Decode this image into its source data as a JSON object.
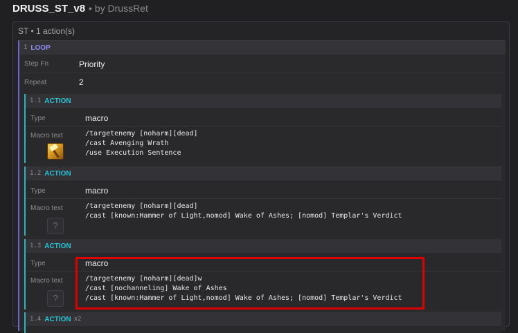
{
  "header": {
    "title": "DRUSS_ST_v8",
    "byline": "• by DrussRet"
  },
  "group": {
    "summary": "ST • 1 action(s)"
  },
  "loop": {
    "num": "1",
    "keyword": "LOOP",
    "step_fn_label": "Step Fn",
    "step_fn_value": "Priority",
    "repeat_label": "Repeat",
    "repeat_value": "2"
  },
  "actions": [
    {
      "num": "1.1",
      "keyword": "ACTION",
      "type_label": "Type",
      "type_value": "macro",
      "macro_label": "Macro text",
      "icon": "avenging-wrath-hammer-icon",
      "macro_text": "/targetenemy [noharm][dead]\n/cast Avenging Wrath\n/use Execution Sentence"
    },
    {
      "num": "1.2",
      "keyword": "ACTION",
      "type_label": "Type",
      "type_value": "macro",
      "macro_label": "Macro text",
      "icon": "question-mark-icon",
      "icon_glyph": "?",
      "macro_text": "/targetenemy [noharm][dead]\n/cast [known:Hammer of Light,nomod] Wake of Ashes; [nomod] Templar's Verdict"
    },
    {
      "num": "1.3",
      "keyword": "ACTION",
      "type_label": "Type",
      "type_value": "macro",
      "macro_label": "Macro text",
      "icon": "question-mark-icon",
      "icon_glyph": "?",
      "macro_text": "/targetenemy [noharm][dead]w\n/cast [nochanneling] Wake of Ashes\n/cast [known:Hammer of Light,nomod] Wake of Ashes; [nomod] Templar's Verdict"
    },
    {
      "num": "1.4",
      "keyword": "ACTION",
      "suffix": "x2"
    }
  ],
  "colors": {
    "loop_accent": "#8f8cf0",
    "action_accent": "#28c4d4",
    "highlight": "#e00000"
  }
}
